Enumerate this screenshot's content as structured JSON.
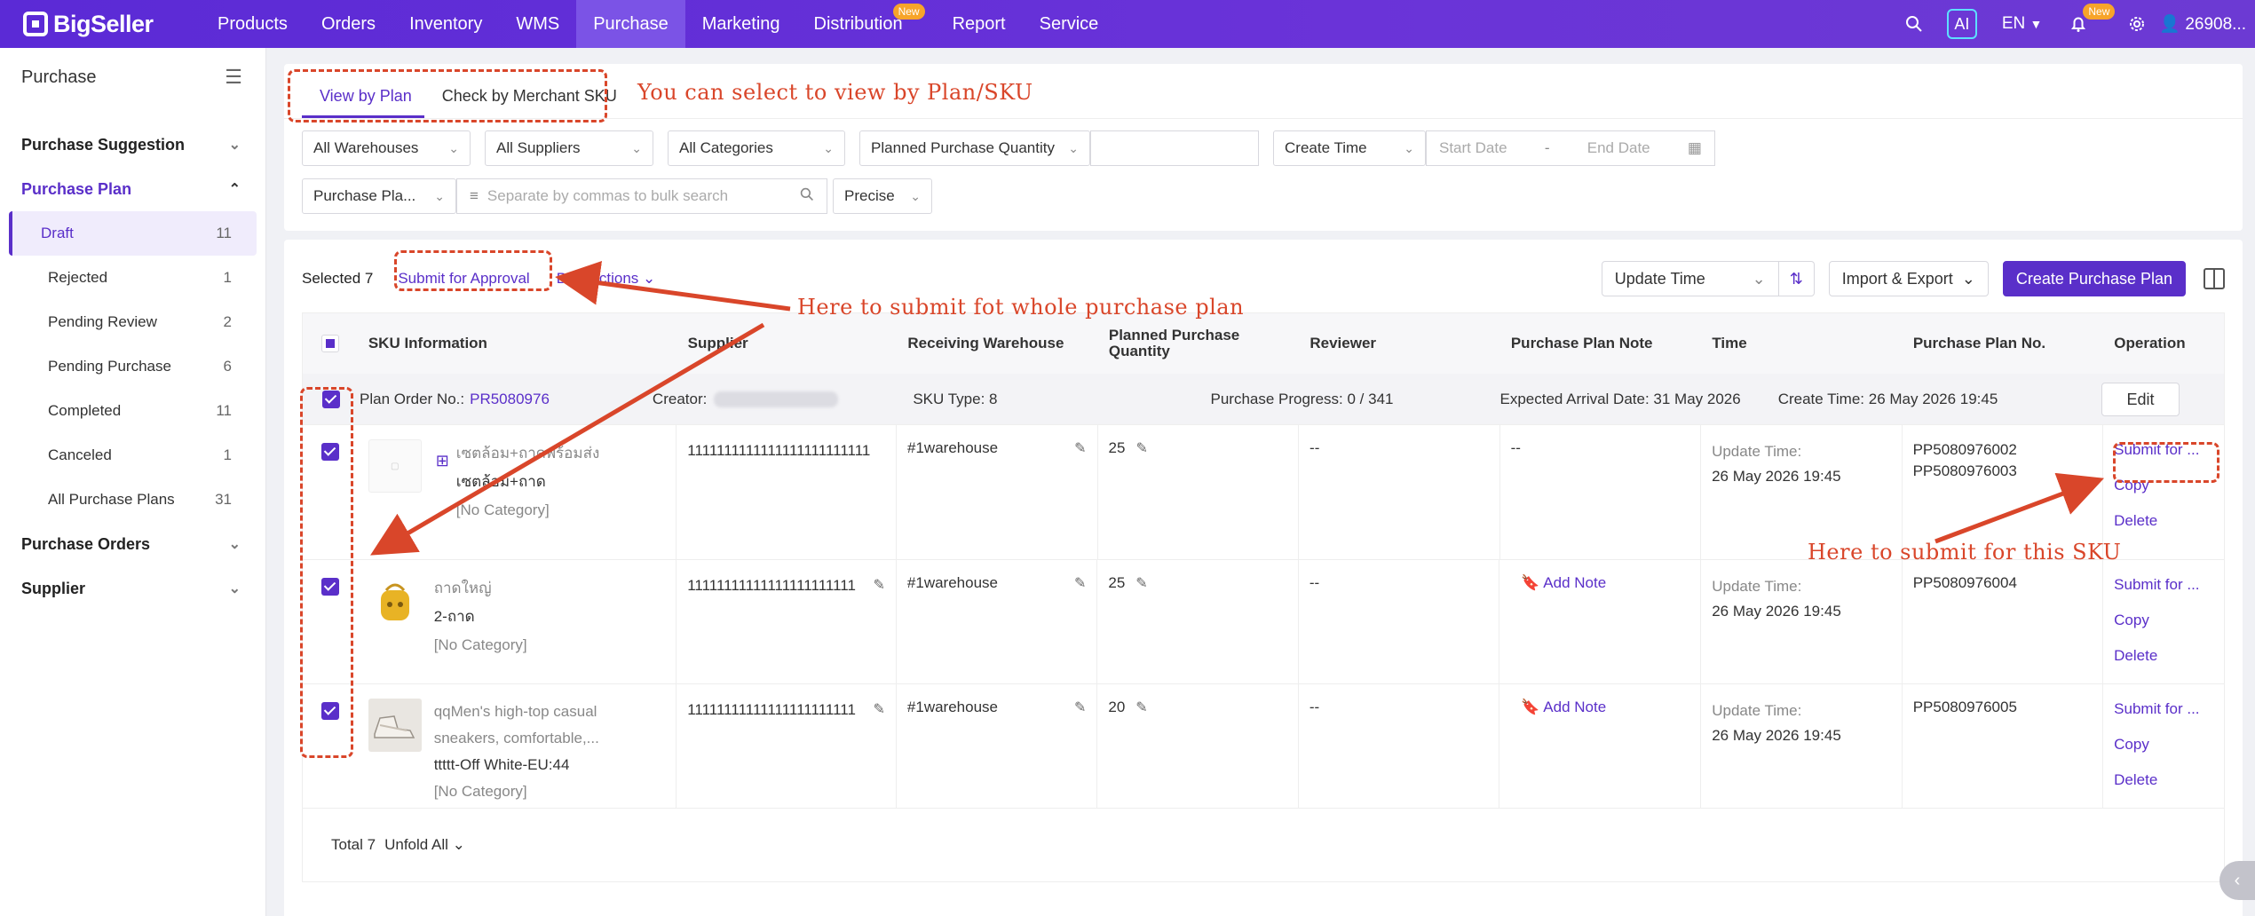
{
  "topnav": {
    "brand": "BigSeller",
    "items": [
      {
        "label": "Products"
      },
      {
        "label": "Orders"
      },
      {
        "label": "Inventory"
      },
      {
        "label": "WMS"
      },
      {
        "label": "Purchase",
        "active": true
      },
      {
        "label": "Marketing"
      },
      {
        "label": "Distribution",
        "badge": "New"
      },
      {
        "label": "Report"
      },
      {
        "label": "Service"
      }
    ],
    "ai": "AI",
    "lang": "EN",
    "bell_badge": "New",
    "user": "26908..."
  },
  "sidebar": {
    "title": "Purchase",
    "groups": {
      "suggestion": "Purchase Suggestion",
      "plan": "Purchase Plan",
      "orders": "Purchase Orders",
      "supplier": "Supplier"
    },
    "items": [
      {
        "label": "Draft",
        "count": "11"
      },
      {
        "label": "Rejected",
        "count": "1"
      },
      {
        "label": "Pending Review",
        "count": "2"
      },
      {
        "label": "Pending Purchase",
        "count": "6"
      },
      {
        "label": "Completed",
        "count": "11"
      },
      {
        "label": "Canceled",
        "count": "1"
      },
      {
        "label": "All Purchase Plans",
        "count": "31"
      }
    ]
  },
  "tabs": {
    "plan": "View by Plan",
    "sku": "Check by Merchant SKU"
  },
  "filters": {
    "warehouses": "All Warehouses",
    "suppliers": "All Suppliers",
    "categories": "All Categories",
    "qty": "Planned Purchase Quantity",
    "create_time": "Create Time",
    "start_date": "Start Date",
    "end_date": "End Date",
    "plan_field": "Purchase Pla...",
    "search_placeholder": "Separate by commas to bulk search",
    "precise": "Precise"
  },
  "actions": {
    "selected": "Selected 7",
    "submit": "Submit for Approval",
    "bulk": "Bulk Actions",
    "update_time": "Update Time",
    "import_export": "Import & Export",
    "create": "Create Purchase Plan"
  },
  "columns": {
    "sku": "SKU Information",
    "supplier": "Supplier",
    "warehouse": "Receiving Warehouse",
    "qty": "Planned Purchase Quantity",
    "reviewer": "Reviewer",
    "note": "Purchase Plan Note",
    "time": "Time",
    "plan_no": "Purchase Plan No.",
    "operation": "Operation"
  },
  "plan": {
    "order_label": "Plan Order No.:",
    "order_no": "PR5080976",
    "creator_label": "Creator:",
    "sku_type": "SKU Type: 8",
    "progress": "Purchase Progress: 0 / 341",
    "arrival": "Expected Arrival Date: 31 May 2026",
    "create_time": "Create Time: 26 May 2026 19:45",
    "edit": "Edit"
  },
  "rows": [
    {
      "name": "เซตล้อม+ถาดพร้อมส่ง",
      "variant": "เซตล้อม+ถาด",
      "category": "[No Category]",
      "supplier": "1111111111111111111111111",
      "warehouse": "#1warehouse",
      "qty": "25",
      "reviewer": "--",
      "note": "--",
      "time_label": "Update Time:",
      "time": "26 May 2026 19:45",
      "plan_no_1": "PP5080976002",
      "plan_no_2": "PP5080976003",
      "submit": "Submit for ...",
      "copy": "Copy",
      "delete": "Delete"
    },
    {
      "name": "ถาดใหญ่",
      "variant": "2-ถาด",
      "category": "[No Category]",
      "supplier": "11111111111111111111111",
      "warehouse": "#1warehouse",
      "qty": "25",
      "reviewer": "--",
      "note": "Add Note",
      "time_label": "Update Time:",
      "time": "26 May 2026 19:45",
      "plan_no_1": "PP5080976004",
      "submit": "Submit for ...",
      "copy": "Copy",
      "delete": "Delete"
    },
    {
      "name": "qqMen's high-top casual sneakers, comfortable,...",
      "variant": "ttttt-Off White-EU:44",
      "category": "[No Category]",
      "supplier": "11111111111111111111111",
      "warehouse": "#1warehouse",
      "qty": "20",
      "reviewer": "--",
      "note": "Add Note",
      "time_label": "Update Time:",
      "time": "26 May 2026 19:45",
      "plan_no_1": "PP5080976005",
      "submit": "Submit for ...",
      "copy": "Copy",
      "delete": "Delete"
    }
  ],
  "footer": {
    "total": "Total 7",
    "unfold": "Unfold All"
  },
  "annotations": {
    "tabs_note": "You can select to view by Plan/SKU",
    "whole_plan_note": "Here to submit fot whole purchase plan",
    "sku_note": "Here to submit for this SKU"
  },
  "colors": {
    "brand": "#5a2fc9",
    "annotation": "#d9462a"
  }
}
